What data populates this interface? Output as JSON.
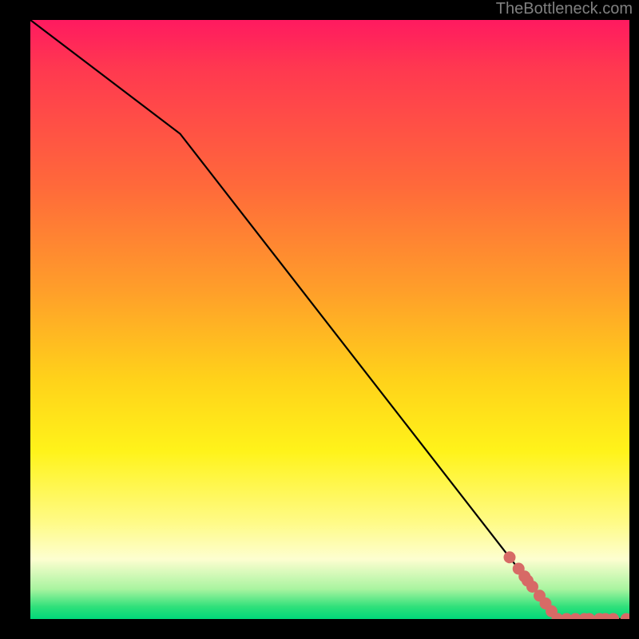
{
  "attribution": "TheBottleneck.com",
  "chart_data": {
    "type": "line",
    "title": "",
    "xlabel": "",
    "ylabel": "",
    "xlim": [
      0,
      100
    ],
    "ylim": [
      0,
      100
    ],
    "grid": false,
    "legend": false,
    "series": [
      {
        "name": "curve",
        "style": "line-black",
        "x": [
          0,
          25,
          88,
          100
        ],
        "y": [
          100,
          81,
          0,
          0
        ]
      },
      {
        "name": "points-on-slope",
        "style": "dots-salmon",
        "x": [
          80,
          81.5,
          82.5,
          83,
          83.8,
          85,
          86,
          87,
          88
        ],
        "y": [
          10.3,
          8.4,
          7.1,
          6.4,
          5.4,
          3.9,
          2.6,
          1.3,
          0
        ]
      },
      {
        "name": "points-on-floor",
        "style": "dots-salmon",
        "x": [
          88,
          89.5,
          91,
          92.5,
          93.3,
          95,
          96,
          97.3,
          99.5
        ],
        "y": [
          0,
          0,
          0,
          0,
          0,
          0,
          0,
          0,
          0
        ]
      }
    ],
    "colors": {
      "line": "#000000",
      "dots": "#d76a66"
    }
  }
}
